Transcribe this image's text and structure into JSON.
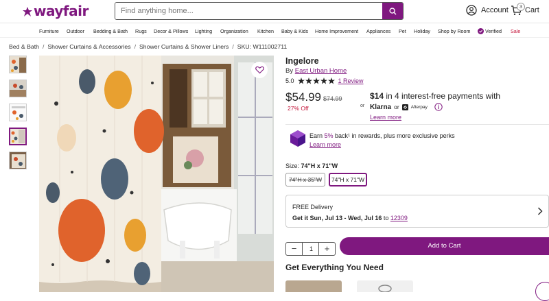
{
  "header": {
    "logo": "wayfair",
    "search_placeholder": "Find anything home...",
    "account_label": "Account",
    "cart_label": "Cart",
    "cart_count": "3",
    "brand_color": "#7f187f"
  },
  "nav": {
    "items": [
      "Furniture",
      "Outdoor",
      "Bedding & Bath",
      "Rugs",
      "Decor & Pillows",
      "Lighting",
      "Organization",
      "Kitchen",
      "Baby & Kids",
      "Home Improvement",
      "Appliances",
      "Pet",
      "Holiday",
      "Shop by Room",
      "Verified",
      "Sale"
    ]
  },
  "breadcrumb": {
    "items": [
      "Bed & Bath",
      "Shower Curtains & Accessories",
      "Shower Curtains & Shower Liners"
    ],
    "separator": "/",
    "sku": "SKU: W111002711"
  },
  "product": {
    "title": "Ingelore",
    "by_prefix": "By",
    "brand": "East Urban Home",
    "rating": "5.0",
    "review_link": "1 Review",
    "price": "$54.99",
    "was_price": "$74.99",
    "discount": "27% Off",
    "or_label": "or",
    "installment_amount": "$14",
    "installment_text": " in 4 interest-free payments with",
    "klarna": "Klarna",
    "or2": "or",
    "afterpay": "Afterpay",
    "learn_more": "Learn more",
    "earn_prefix": "Earn ",
    "earn_percent": "5%",
    "earn_suffix": " back¹ in rewards, plus more exclusive perks",
    "learn_more_2": "Learn more",
    "size_label": "Size: ",
    "size_value": "74\"H x 71\"W",
    "size_options": [
      "74\"H x 35\"W",
      "74\"H x 71\"W"
    ],
    "delivery_title": "FREE Delivery",
    "delivery_prefix": "Get it ",
    "delivery_dates": "Sun, Jul 13 - Wed, Jul 16",
    "delivery_to": " to ",
    "zip": "12309",
    "quantity": "1",
    "add_to_cart": "Add to Cart",
    "get_everything": "Get Everything You Need"
  }
}
